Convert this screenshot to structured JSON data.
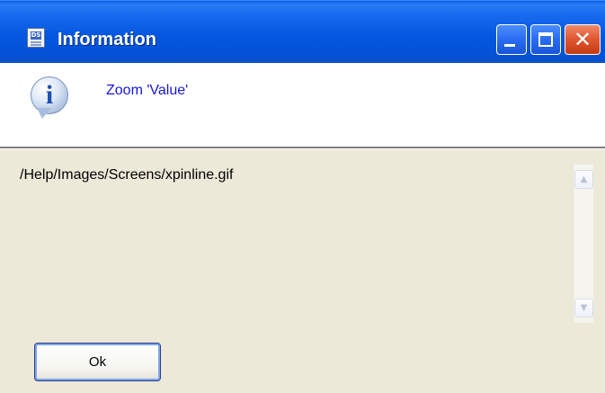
{
  "window": {
    "title": "Information",
    "app_icon_text": "DS",
    "controls": {
      "minimize_icon": "minimize-icon",
      "maximize_icon": "maximize-icon",
      "close_icon": "close-icon",
      "close_glyph": "✕"
    }
  },
  "header": {
    "icon": "information-icon",
    "icon_glyph": "i",
    "message": "Zoom 'Value'"
  },
  "content": {
    "text": "/Help/Images/Screens/xpinline.gif",
    "scroll_up_glyph": "▲",
    "scroll_down_glyph": "▼"
  },
  "buttons": {
    "ok_label": "Ok"
  },
  "colors": {
    "titlebar": "#0557e0",
    "message_text": "#1515e0",
    "body_bg": "#ece9d8",
    "close_button": "#e05a34"
  }
}
